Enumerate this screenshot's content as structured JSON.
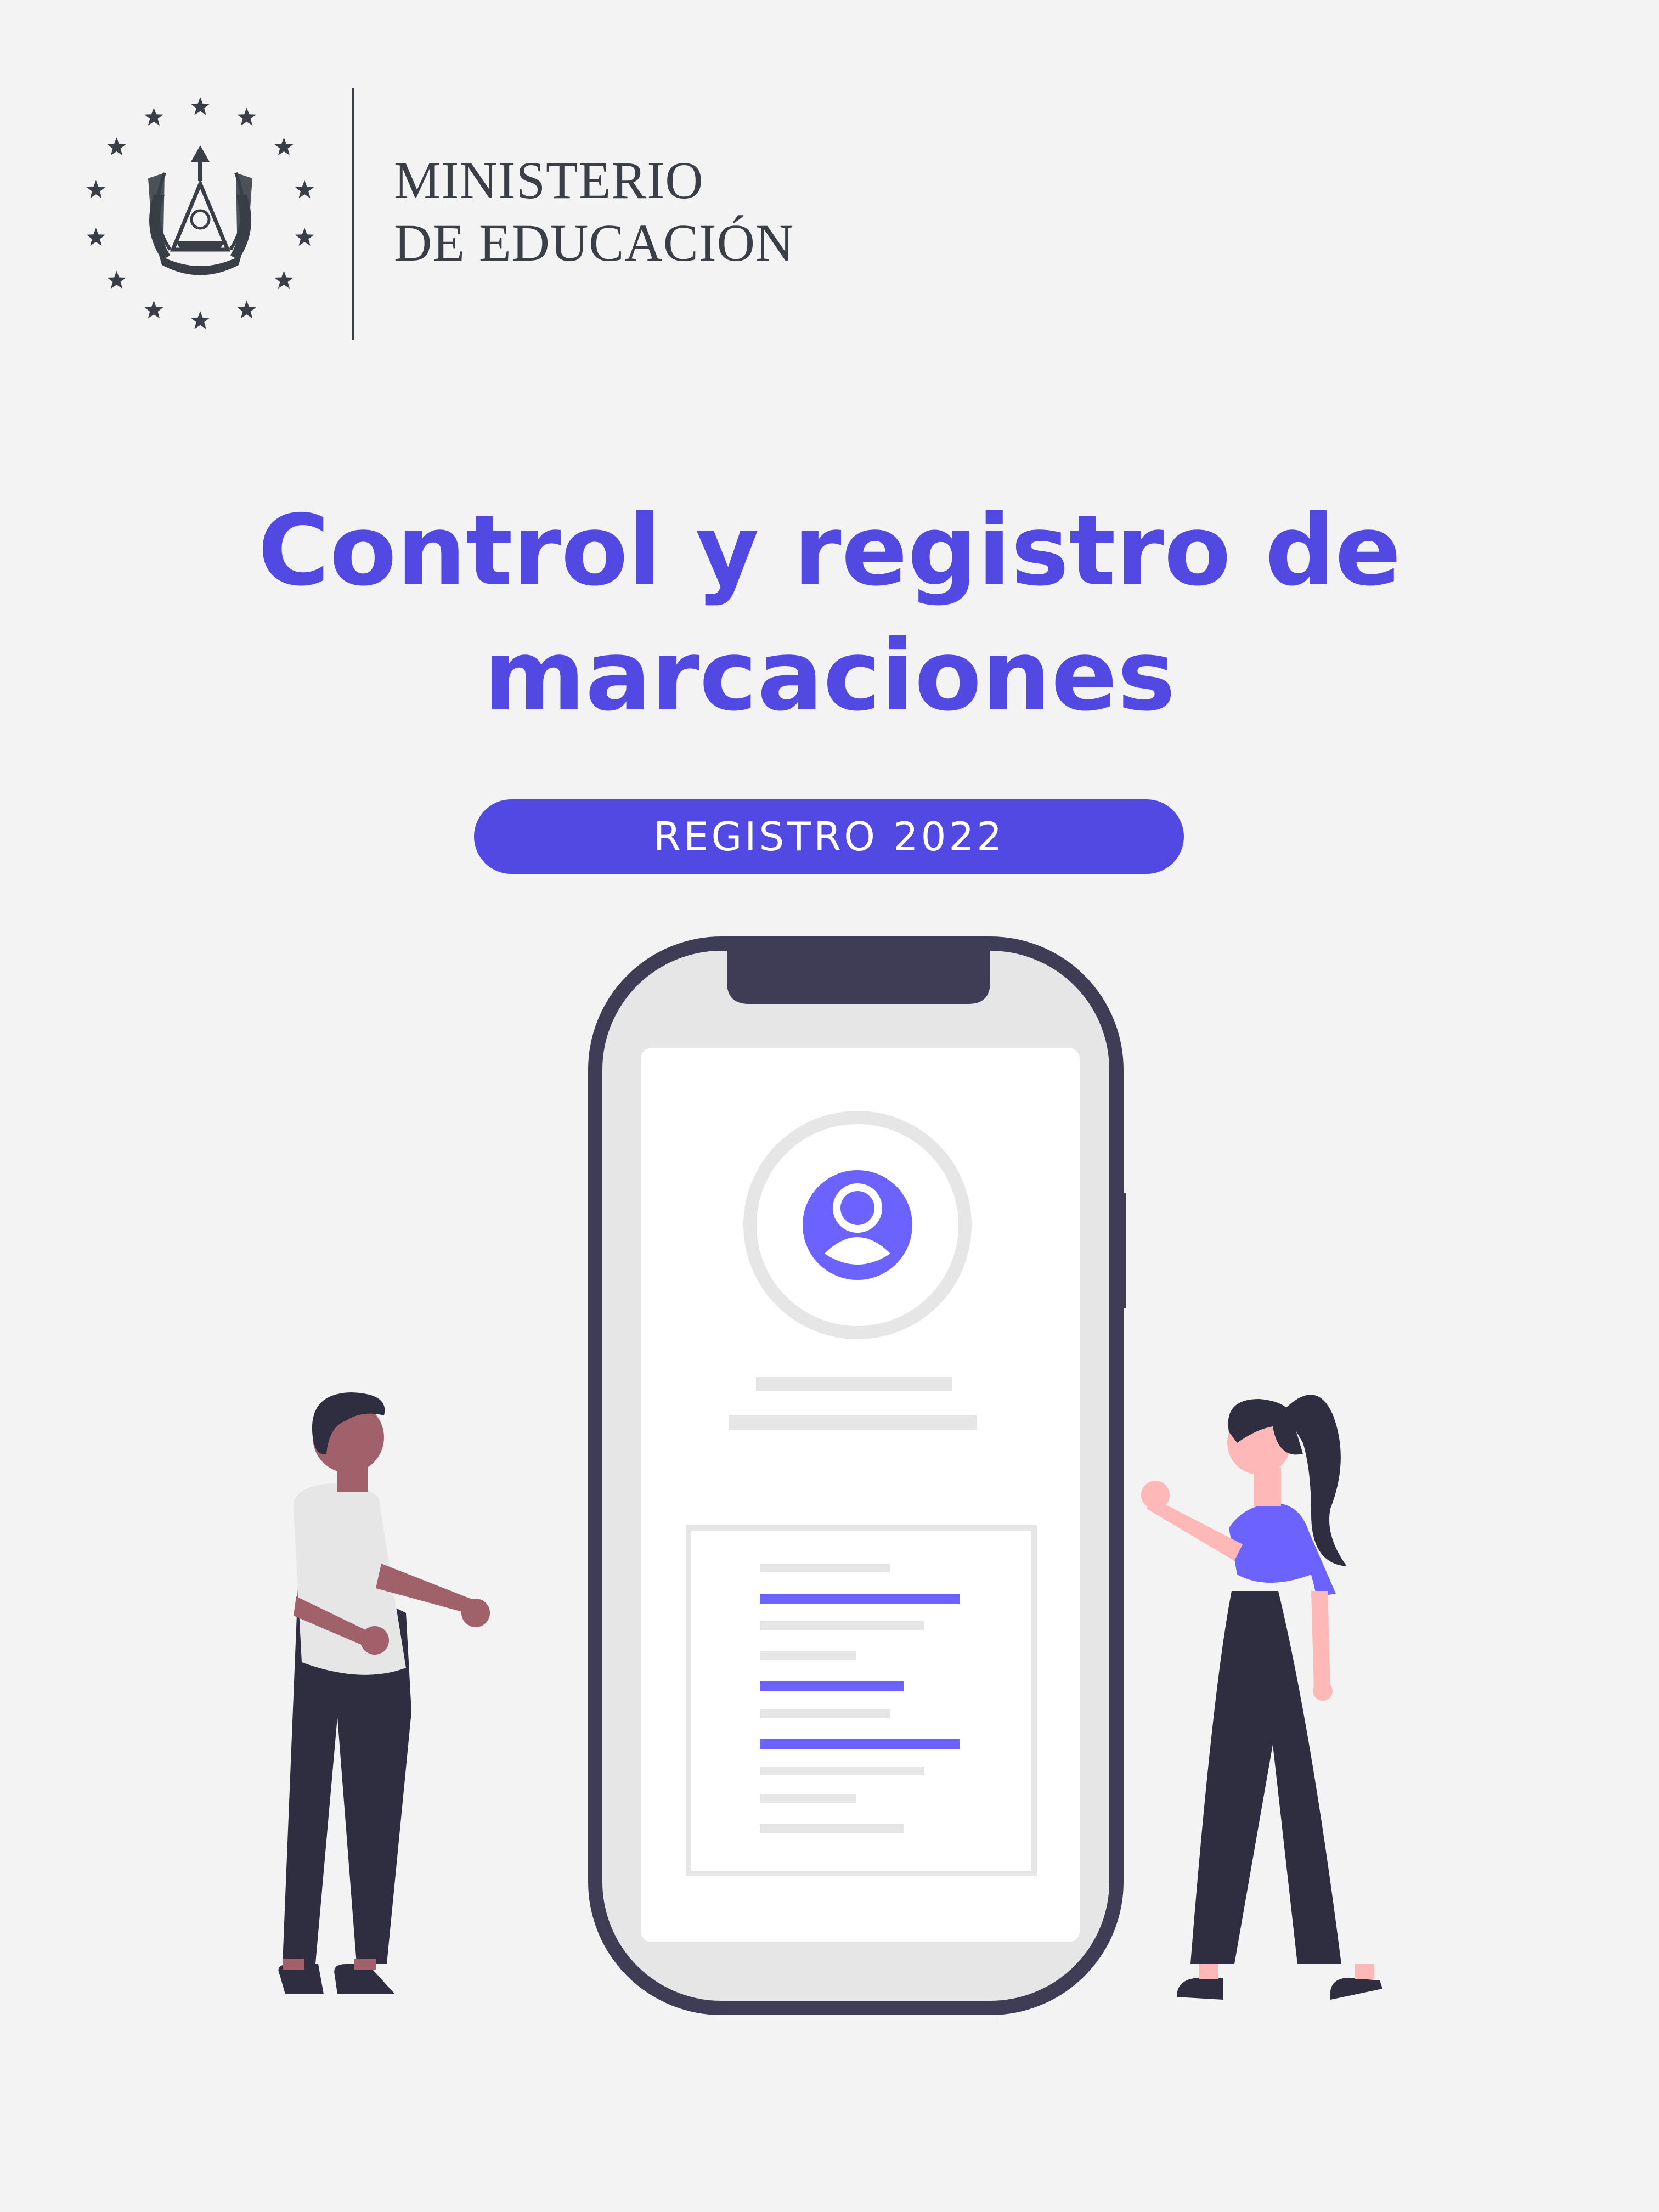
{
  "header": {
    "ministry_line1": "MINISTERIO",
    "ministry_line2": "DE EDUCACIÓN",
    "emblem_icon": "el-salvador-coat-of-arms-icon"
  },
  "cover": {
    "title_line1": "Control y registro de",
    "title_line2": "marcaciones",
    "badge": "REGISTRO 2022"
  },
  "illustration": {
    "phone_icon": "smartphone-profile-icon",
    "user_icon": "user-avatar-icon",
    "people_icons": [
      "man-figure-icon",
      "woman-figure-icon"
    ]
  },
  "colors": {
    "background": "#f3f3f4",
    "accent": "#5249e2",
    "text_dark": "#3a3e46",
    "figure_purple": "#6c63ff",
    "figure_dark": "#2f2e41"
  }
}
